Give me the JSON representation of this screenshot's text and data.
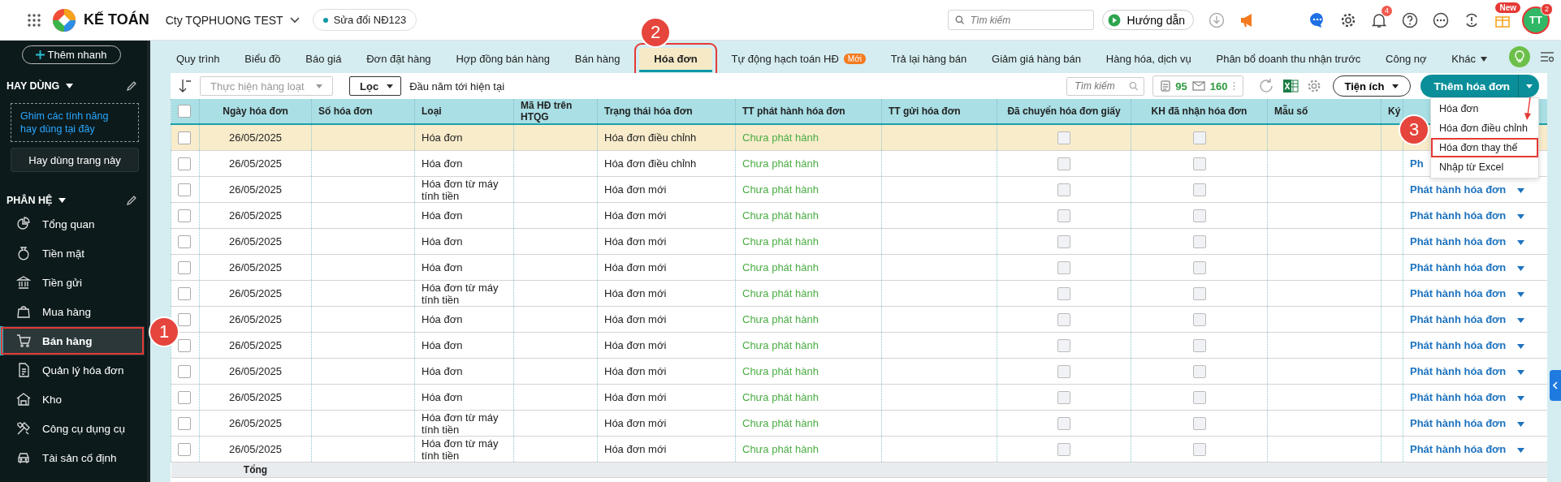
{
  "topbar": {
    "app_name": "KẾ TOÁN",
    "company": "Cty TQPHUONG TEST",
    "version_tag": "Sửa đổi NĐ123",
    "search": {
      "placeholder": "Tìm kiếm"
    },
    "guide_button": "Hướng dẫn",
    "notification_count": "4",
    "gift_badge": "New",
    "avatar": {
      "initials": "TT",
      "badge": "2"
    }
  },
  "sidebar": {
    "quick_add": "Thêm nhanh",
    "favorites": {
      "title": "HAY DÙNG",
      "hint": "Ghim các tính năng hay dùng tại đây",
      "pin_button": "Hay dùng trang này"
    },
    "modules": {
      "title": "PHÂN HỆ",
      "items": [
        {
          "label": "Tổng quan",
          "selected": false
        },
        {
          "label": "Tiền mặt",
          "selected": false
        },
        {
          "label": "Tiền gửi",
          "selected": false
        },
        {
          "label": "Mua hàng",
          "selected": false
        },
        {
          "label": "Bán hàng",
          "selected": true
        },
        {
          "label": "Quản lý hóa đơn",
          "selected": false
        },
        {
          "label": "Kho",
          "selected": false
        },
        {
          "label": "Công cụ dụng cụ",
          "selected": false
        },
        {
          "label": "Tài sản cố định",
          "selected": false
        }
      ]
    }
  },
  "tabs": [
    {
      "label": "Quy trình",
      "selected": false
    },
    {
      "label": "Biểu đồ",
      "selected": false
    },
    {
      "label": "Báo giá",
      "selected": false
    },
    {
      "label": "Đơn đặt hàng",
      "selected": false
    },
    {
      "label": "Hợp đồng bán hàng",
      "selected": false
    },
    {
      "label": "Bán hàng",
      "selected": false
    },
    {
      "label": "Hóa đơn",
      "selected": true
    },
    {
      "label": "Tự động hạch toán HĐ",
      "selected": false,
      "badge": "Mới"
    },
    {
      "label": "Trả lại hàng bán",
      "selected": false
    },
    {
      "label": "Giảm giá hàng bán",
      "selected": false
    },
    {
      "label": "Hàng hóa, dịch vụ",
      "selected": false
    },
    {
      "label": "Phân bổ doanh thu nhận trước",
      "selected": false
    },
    {
      "label": "Công nợ",
      "selected": false
    }
  ],
  "more_tab": "Khác",
  "toolbar": {
    "batch_action": {
      "label": "Thực hiện hàng loạt",
      "disabled": true
    },
    "filter": "Lọc",
    "period": "Đầu năm tới hiện tại",
    "search": {
      "placeholder": "Tìm kiếm"
    },
    "counts": [
      "95",
      "160"
    ],
    "utilities": "Tiện ích",
    "add_button": "Thêm hóa đơn",
    "add_menu": {
      "open": true,
      "items": [
        {
          "label": "Hóa đơn",
          "highlighted": false
        },
        {
          "label": "Hóa đơn điều chỉnh",
          "highlighted": false
        },
        {
          "label": "Hóa đơn thay thế",
          "highlighted": true
        },
        {
          "label": "Nhập từ Excel",
          "highlighted": false
        }
      ]
    }
  },
  "table": {
    "select_all": false,
    "columns": [
      "Ngày hóa đơn",
      "Số hóa đơn",
      "Loại",
      "Mã HĐ trên HTQG",
      "Trạng thái hóa đơn",
      "TT phát hành hóa đơn",
      "TT gửi hóa đơn",
      "Đã chuyển hóa đơn giấy",
      "KH đã nhận hóa đơn",
      "Mẫu số",
      "Ký"
    ],
    "rows": [
      {
        "selected": true,
        "checked": false,
        "date": "26/05/2025",
        "type": "Hóa đơn",
        "status": "Hóa đơn điều chỉnh",
        "issue_status": "Chưa phát hành",
        "paper_converted": false,
        "customer_received": false
      },
      {
        "selected": false,
        "checked": false,
        "date": "26/05/2025",
        "type": "Hóa đơn",
        "status": "Hóa đơn điều chỉnh",
        "issue_status": "Chưa phát hành",
        "paper_converted": false,
        "customer_received": false,
        "action": "Ph"
      },
      {
        "selected": false,
        "checked": false,
        "date": "26/05/2025",
        "type": "Hóa đơn từ máy tính tiền",
        "status": "Hóa đơn mới",
        "issue_status": "Chưa phát hành",
        "paper_converted": false,
        "customer_received": false,
        "action": "Phát hành hóa đơn",
        "caret": true
      },
      {
        "selected": false,
        "checked": false,
        "date": "26/05/2025",
        "type": "Hóa đơn",
        "status": "Hóa đơn mới",
        "issue_status": "Chưa phát hành",
        "paper_converted": false,
        "customer_received": false,
        "action": "Phát hành hóa đơn",
        "caret": true
      },
      {
        "selected": false,
        "checked": false,
        "date": "26/05/2025",
        "type": "Hóa đơn",
        "status": "Hóa đơn mới",
        "issue_status": "Chưa phát hành",
        "paper_converted": false,
        "customer_received": false,
        "action": "Phát hành hóa đơn",
        "caret": true
      },
      {
        "selected": false,
        "checked": false,
        "date": "26/05/2025",
        "type": "Hóa đơn",
        "status": "Hóa đơn mới",
        "issue_status": "Chưa phát hành",
        "paper_converted": false,
        "customer_received": false,
        "action": "Phát hành hóa đơn",
        "caret": true
      },
      {
        "selected": false,
        "checked": false,
        "date": "26/05/2025",
        "type": "Hóa đơn từ máy tính tiền",
        "status": "Hóa đơn mới",
        "issue_status": "Chưa phát hành",
        "paper_converted": false,
        "customer_received": false,
        "action": "Phát hành hóa đơn",
        "caret": true
      },
      {
        "selected": false,
        "checked": false,
        "date": "26/05/2025",
        "type": "Hóa đơn",
        "status": "Hóa đơn mới",
        "issue_status": "Chưa phát hành",
        "paper_converted": false,
        "customer_received": false,
        "action": "Phát hành hóa đơn",
        "caret": true
      },
      {
        "selected": false,
        "checked": false,
        "date": "26/05/2025",
        "type": "Hóa đơn",
        "status": "Hóa đơn mới",
        "issue_status": "Chưa phát hành",
        "paper_converted": false,
        "customer_received": false,
        "action": "Phát hành hóa đơn",
        "caret": true
      },
      {
        "selected": false,
        "checked": false,
        "date": "26/05/2025",
        "type": "Hóa đơn",
        "status": "Hóa đơn mới",
        "issue_status": "Chưa phát hành",
        "paper_converted": false,
        "customer_received": false,
        "action": "Phát hành hóa đơn",
        "caret": true
      },
      {
        "selected": false,
        "checked": false,
        "date": "26/05/2025",
        "type": "Hóa đơn",
        "status": "Hóa đơn mới",
        "issue_status": "Chưa phát hành",
        "paper_converted": false,
        "customer_received": false,
        "action": "Phát hành hóa đơn",
        "caret": true
      },
      {
        "selected": false,
        "checked": false,
        "date": "26/05/2025",
        "type": "Hóa đơn từ máy tính tiền",
        "status": "Hóa đơn mới",
        "issue_status": "Chưa phát hành",
        "paper_converted": false,
        "customer_received": false,
        "action": "Phát hành hóa đơn",
        "caret": true
      },
      {
        "selected": false,
        "checked": false,
        "date": "26/05/2025",
        "type": "Hóa đơn từ máy tính tiền",
        "status": "Hóa đơn mới",
        "issue_status": "Chưa phát hành",
        "paper_converted": false,
        "customer_received": false,
        "action": "Phát hành hóa đơn",
        "caret": true
      }
    ],
    "total_label": "Tổng"
  },
  "callouts": [
    {
      "number": "1"
    },
    {
      "number": "2"
    },
    {
      "number": "3"
    }
  ]
}
